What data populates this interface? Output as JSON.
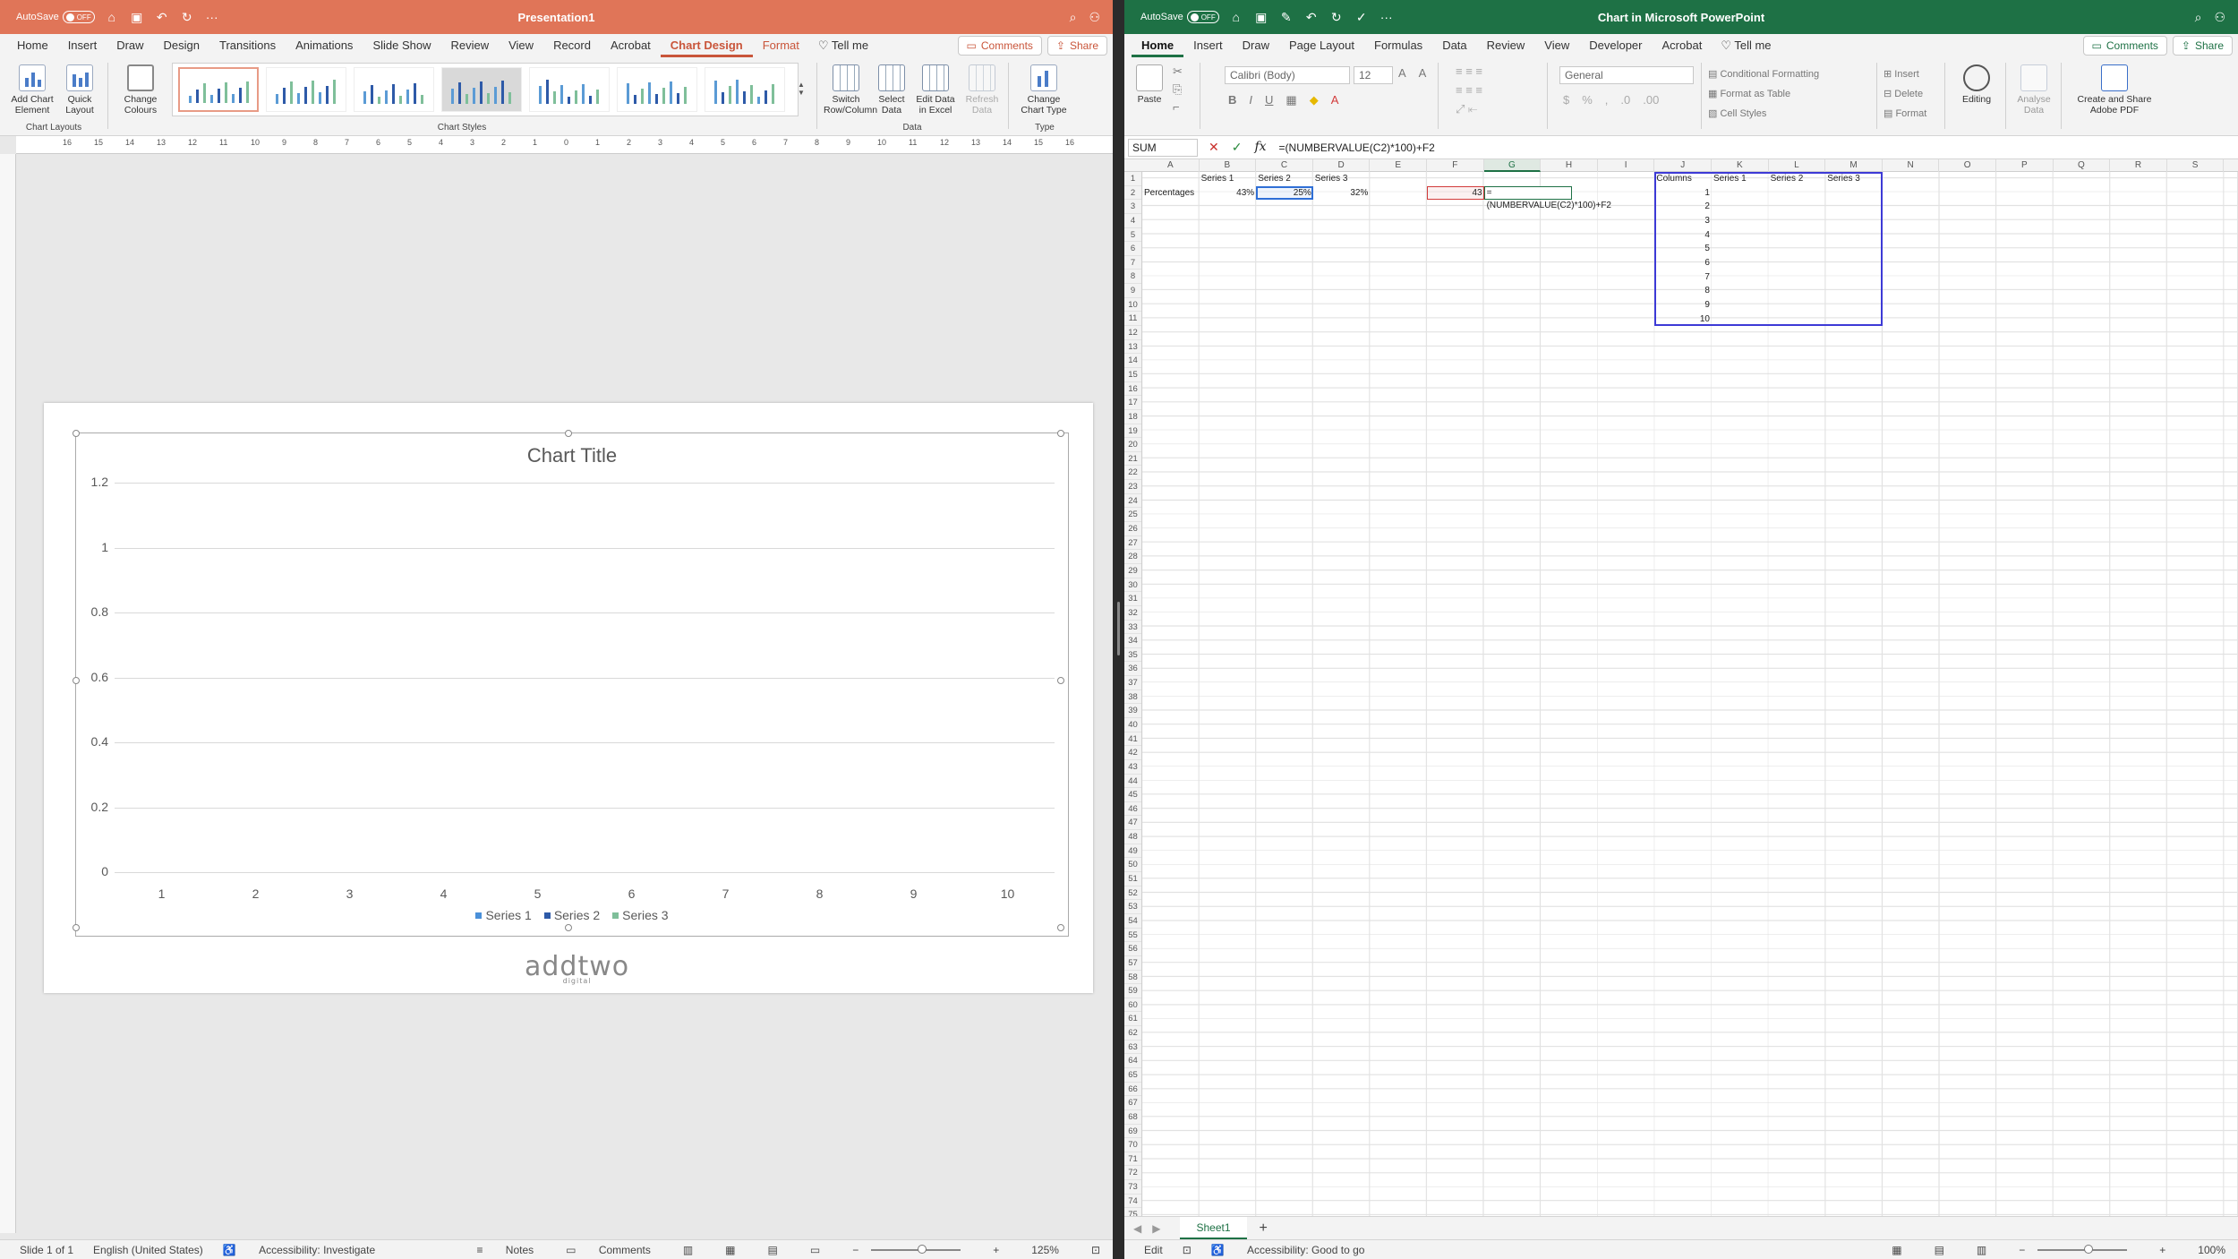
{
  "ppt": {
    "autosave_label": "AutoSave",
    "autosave_state": "OFF",
    "doc_title": "Presentation1",
    "tabs": [
      "Home",
      "Insert",
      "Draw",
      "Design",
      "Transitions",
      "Animations",
      "Slide Show",
      "Review",
      "View",
      "Record",
      "Acrobat",
      "Chart Design",
      "Format"
    ],
    "active_tab": "Chart Design",
    "tell_me": "Tell me",
    "comments": "Comments",
    "share": "Share",
    "ribbon": {
      "add_chart_element": "Add Chart Element",
      "quick_layout": "Quick Layout",
      "change_colours": "Change Colours",
      "switch_row_column": "Switch Row/Column",
      "select_data": "Select Data",
      "edit_data_excel": "Edit Data in Excel",
      "refresh_data": "Refresh Data",
      "change_chart_type": "Change Chart Type",
      "group_chart_layouts": "Chart Layouts",
      "group_chart_styles": "Chart Styles",
      "group_data": "Data",
      "group_type": "Type"
    },
    "ruler_labels": [
      "16",
      "15",
      "14",
      "13",
      "12",
      "11",
      "10",
      "9",
      "8",
      "7",
      "6",
      "5",
      "4",
      "3",
      "2",
      "1",
      "0",
      "1",
      "2",
      "3",
      "4",
      "5",
      "6",
      "7",
      "8",
      "9",
      "10",
      "11",
      "12",
      "13",
      "14",
      "15",
      "16"
    ],
    "logo_text": "addtwo",
    "logo_sub": "digital",
    "status": {
      "slide": "Slide 1 of 1",
      "language": "English (United States)",
      "accessibility": "Accessibility: Investigate",
      "notes": "Notes",
      "comments": "Comments",
      "zoom": "125%"
    }
  },
  "chart_data": {
    "type": "bar",
    "title": "Chart Title",
    "categories": [
      "1",
      "2",
      "3",
      "4",
      "5",
      "6",
      "7",
      "8",
      "9",
      "10"
    ],
    "series": [
      {
        "name": "Series 1",
        "values": [],
        "color": "#4a90d9"
      },
      {
        "name": "Series 2",
        "values": [],
        "color": "#2e5aa8"
      },
      {
        "name": "Series 3",
        "values": [],
        "color": "#7fbf9a"
      }
    ],
    "yticks": [
      "1.2",
      "1",
      "0.8",
      "0.6",
      "0.4",
      "0.2",
      "0"
    ],
    "ylim": [
      0,
      1.2
    ],
    "grid": true,
    "legend": "bottom"
  },
  "excel": {
    "autosave_label": "AutoSave",
    "autosave_state": "OFF",
    "doc_title": "Chart in Microsoft PowerPoint",
    "tabs": [
      "Home",
      "Insert",
      "Draw",
      "Page Layout",
      "Formulas",
      "Data",
      "Review",
      "View",
      "Developer",
      "Acrobat"
    ],
    "active_tab": "Home",
    "tell_me": "Tell me",
    "comments": "Comments",
    "share": "Share",
    "ribbon": {
      "paste": "Paste",
      "font_name": "Calibri (Body)",
      "font_size": "12",
      "number_format": "General",
      "conditional_formatting": "Conditional Formatting",
      "format_as_table": "Format as Table",
      "cell_styles": "Cell Styles",
      "insert": "Insert",
      "delete": "Delete",
      "format": "Format",
      "editing": "Editing",
      "analyse_data": "Analyse Data",
      "create_share_pdf": "Create and Share Adobe PDF"
    },
    "name_box": "SUM",
    "formula": "=(NUMBERVALUE(C2)*100)+F2",
    "columns": [
      "A",
      "B",
      "C",
      "D",
      "E",
      "F",
      "G",
      "H",
      "I",
      "J",
      "K",
      "L",
      "M",
      "N",
      "O",
      "P",
      "Q",
      "R",
      "S"
    ],
    "cells": {
      "B1": "Series 1",
      "C1": "Series 2",
      "D1": "Series 3",
      "A2": "Percentages",
      "B2": "43%",
      "C2": "25%",
      "D2": "32%",
      "F2": "43",
      "G2_edit": "=(NUMBERVALUE(C2)*100)+F2",
      "J1": "Columns",
      "K1": "Series 1",
      "L1": "Series 2",
      "M1": "Series 3",
      "J_values": [
        "1",
        "2",
        "3",
        "4",
        "5",
        "6",
        "7",
        "8",
        "9",
        "10"
      ]
    },
    "sheet_tab": "Sheet1",
    "status": {
      "mode": "Edit",
      "accessibility": "Accessibility: Good to go",
      "zoom": "100%"
    }
  }
}
